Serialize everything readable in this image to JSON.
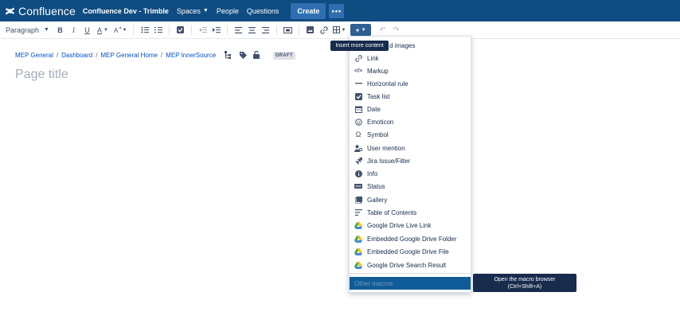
{
  "app": {
    "logo": "Confluence",
    "site_name": "Confluence Dev - Trimble",
    "nav": {
      "spaces": "Spaces",
      "people": "People",
      "questions": "Questions"
    },
    "create": "Create",
    "more": "•••"
  },
  "toolbar": {
    "paragraph": "Paragraph",
    "bold": "B",
    "italic": "I",
    "underline": "U",
    "text_color": "A",
    "insert_label": "+"
  },
  "breadcrumb": [
    "MEP General",
    "Dashboard",
    "MEP General Home",
    "MEP InnerSource"
  ],
  "status_badge": "DRAFT",
  "editor": {
    "title_placeholder": "Page title"
  },
  "tooltips": {
    "insert": "Insert more content",
    "macro_line1": "Open the macro browser",
    "macro_line2": "(Ctrl+Shift+A)"
  },
  "insert_menu": {
    "partial_first_item": "d images",
    "items": [
      {
        "label": "Link",
        "icon": "link-icon"
      },
      {
        "label": "Markup",
        "icon": "code-icon"
      },
      {
        "label": "Horizontal rule",
        "icon": "horizontal-rule-icon"
      },
      {
        "label": "Task list",
        "icon": "checkbox-icon"
      },
      {
        "label": "Date",
        "icon": "calendar-icon"
      },
      {
        "label": "Emoticon",
        "icon": "smiley-icon"
      },
      {
        "label": "Symbol",
        "icon": "omega-icon"
      },
      {
        "label": "User mention",
        "icon": "user-icon"
      },
      {
        "label": "Jira Issue/Filter",
        "icon": "jira-icon"
      },
      {
        "label": "Info",
        "icon": "info-icon"
      },
      {
        "label": "Status",
        "icon": "status-icon"
      },
      {
        "label": "Gallery",
        "icon": "gallery-icon"
      },
      {
        "label": "Table of Contents",
        "icon": "toc-icon"
      },
      {
        "label": "Google Drive Live Link",
        "icon": "google-drive-icon"
      },
      {
        "label": "Embedded Google Drive Folder",
        "icon": "google-drive-icon"
      },
      {
        "label": "Embedded Google Drive File",
        "icon": "google-drive-icon"
      },
      {
        "label": "Google Drive Search Result",
        "icon": "google-drive-icon"
      }
    ],
    "other_macros": "Other macros"
  },
  "colors": {
    "nav_bg": "#0f4c81",
    "accent": "#0052cc",
    "highlight": "#0f5c99"
  }
}
